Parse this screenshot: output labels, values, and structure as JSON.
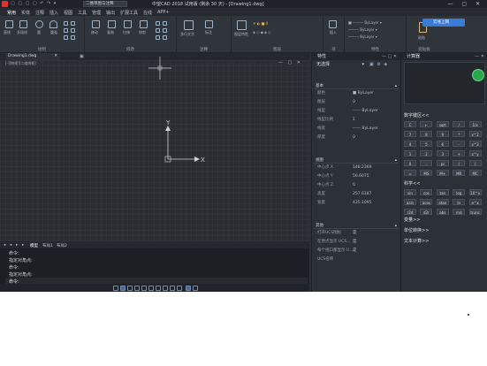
{
  "titlebar": {
    "title": "中望CAD 2018 试用版 (剩余 30 天) - [Drawing1.dwg]",
    "workspace": "二维草图与注释",
    "window_controls": "—  ▢  ✕"
  },
  "menubar": {
    "items": [
      "常用",
      "实体",
      "注释",
      "插入",
      "视图",
      "工具",
      "管理",
      "输出",
      "扩展工具",
      "在线",
      "APP+"
    ]
  },
  "ribbon": {
    "groups": [
      {
        "label": "绘制",
        "tools": [
          "直线",
          "多段线",
          "圆",
          "圆弧"
        ]
      },
      {
        "label": "修改",
        "tools": [
          "移动",
          "复制",
          "拉伸",
          "修剪"
        ]
      },
      {
        "label": "注释",
        "tools": [
          "多行文字",
          "标注"
        ]
      },
      {
        "label": "图层",
        "tools": [
          "图层特性"
        ]
      },
      {
        "label": "块",
        "tools": [
          "插入"
        ]
      },
      {
        "label": "特性",
        "tools": [
          "ByLayer"
        ]
      },
      {
        "label": "剪贴板",
        "tools": [
          "粘贴"
        ]
      }
    ],
    "cloud_button": "云线上网"
  },
  "drawing_tab": "Drawing1.dwg",
  "viewport": {
    "label": "[-][俯视][二维线框]",
    "controls": "— ▢ ✕"
  },
  "ucs": {
    "x_label": "X",
    "y_label": "Y"
  },
  "layout_tabs": [
    "◂",
    "◂",
    "▸",
    "▸",
    "模型",
    "布局1",
    "布局2"
  ],
  "command": {
    "lines": [
      "命令:",
      "指定对角点:",
      "命令:",
      "指定对角点:"
    ],
    "prompt": "命令:"
  },
  "properties": {
    "title": "特性",
    "selection": "无选择",
    "sections": [
      {
        "name": "基本",
        "rows": [
          {
            "label": "颜色",
            "value": "■ ByLayer"
          },
          {
            "label": "图层",
            "value": "0"
          },
          {
            "label": "线型",
            "value": "—— ByLayer"
          },
          {
            "label": "线型比例",
            "value": "1"
          },
          {
            "label": "线宽",
            "value": "—— ByLayer"
          },
          {
            "label": "厚度",
            "value": "0"
          }
        ]
      },
      {
        "name": "视图",
        "rows": [
          {
            "label": "中心点 X",
            "value": "148.2369"
          },
          {
            "label": "中心点 Y",
            "value": "56.6075"
          },
          {
            "label": "中心点 Z",
            "value": "0"
          },
          {
            "label": "高度",
            "value": "257.6187"
          },
          {
            "label": "宽度",
            "value": "435.1095"
          }
        ]
      },
      {
        "name": "其他",
        "rows": [
          {
            "label": "打开UCS图标",
            "value": "是"
          },
          {
            "label": "在原点显示 UCS...",
            "value": "是"
          },
          {
            "label": "每个视口都显示 U...",
            "value": "是"
          },
          {
            "label": "UCS名称",
            "value": ""
          }
        ]
      }
    ]
  },
  "calculator": {
    "title": "计算器",
    "numpad_label": "数字键区<<",
    "numpad_keys": [
      [
        "C",
        "←",
        "sqrt",
        "/",
        "1/x"
      ],
      [
        "7",
        "8",
        "9",
        "*",
        "x^2"
      ],
      [
        "4",
        "5",
        "6",
        "-",
        "x^3"
      ],
      [
        "1",
        "2",
        "3",
        "+",
        "x^y"
      ],
      [
        "0",
        ".",
        "pi",
        "(",
        ")"
      ],
      [
        "=",
        "MS",
        "M+",
        "MR",
        "MC"
      ]
    ],
    "sci_label": "科学<<",
    "sci_keys": [
      [
        "sin",
        "cos",
        "tan",
        "log",
        "10^x"
      ],
      [
        "asin",
        "acos",
        "atan",
        "ln",
        "e^x"
      ],
      [
        "r2d",
        "d2r",
        "abs",
        "rnd",
        "trunc"
      ]
    ],
    "collapsed": [
      "变量>>",
      "单位转换>>",
      "文本计算>>"
    ]
  }
}
